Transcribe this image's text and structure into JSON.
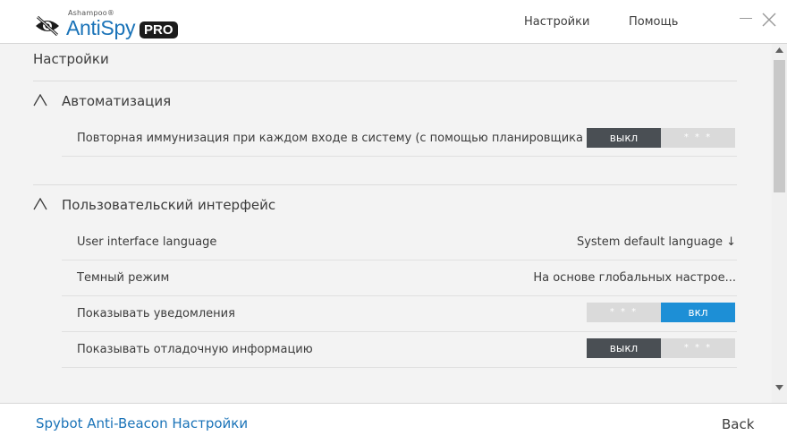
{
  "header": {
    "brand": "Ashampoo®",
    "app_name": "AntiSpy",
    "edition": "PRO",
    "nav": {
      "settings": "Настройки",
      "help": "Помощь"
    },
    "logo_icon": "eye-icon"
  },
  "page": {
    "title": "Настройки"
  },
  "sections": [
    {
      "title": "Автоматизация",
      "rows": [
        {
          "label": "Повторная иммунизация при каждом входе в систему (с помощью планировщика задач)",
          "toggle_off": "выкл",
          "toggle_on": "* * *",
          "state": "off"
        }
      ]
    },
    {
      "title": "Пользовательский интерфейс",
      "rows": [
        {
          "label": "User interface language",
          "value": "System default language ↓"
        },
        {
          "label": "Темный режим",
          "value": "На основе глобальных настрое..."
        },
        {
          "label": "Показывать уведомления",
          "toggle_off": "* * *",
          "toggle_on": "вкл",
          "state": "on"
        },
        {
          "label": "Показывать отладочную информацию",
          "toggle_off": "выкл",
          "toggle_on": "* * *",
          "state": "off"
        }
      ]
    }
  ],
  "footer": {
    "link": "Spybot Anti-Beacon Настройки",
    "back": "Back"
  },
  "colors": {
    "accent": "#1d8fd6",
    "brand_blue": "#1a73b8",
    "toggle_off": "#4a4f54",
    "toggle_inactive": "#dadada"
  }
}
